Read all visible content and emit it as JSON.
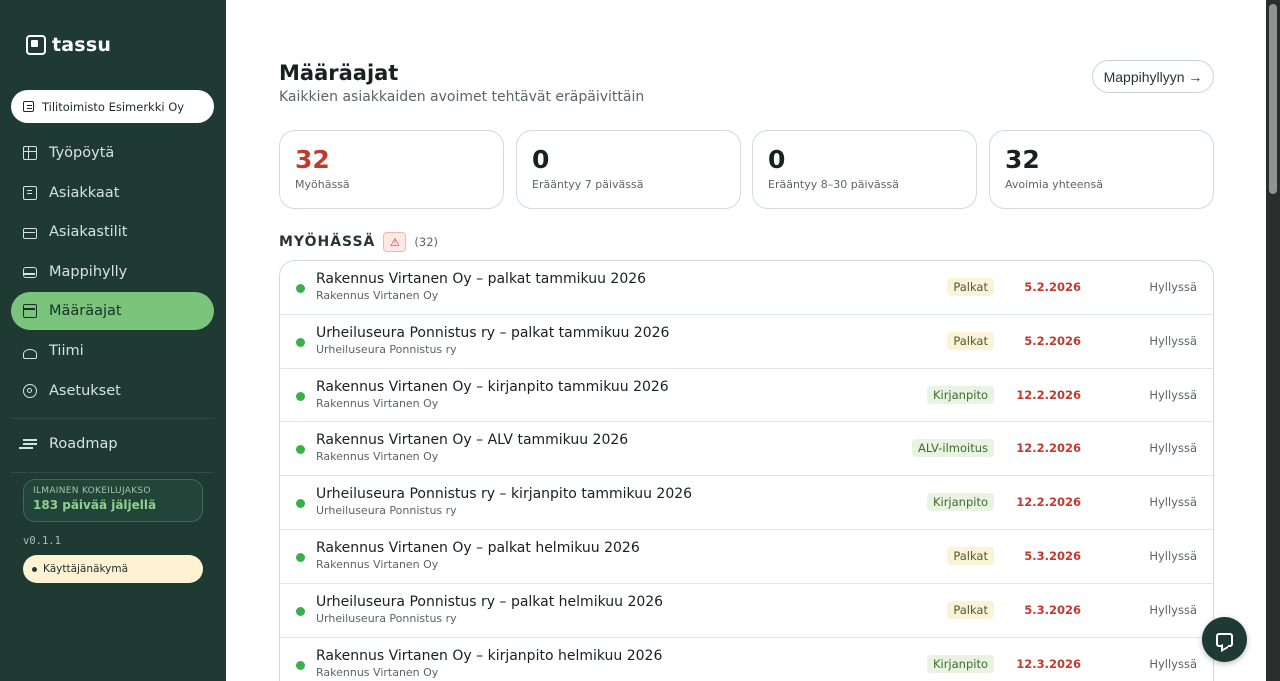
{
  "brand": {
    "name": "tassu"
  },
  "org_selector": {
    "label": "Tilitoimisto Esimerkki Oy"
  },
  "nav": [
    {
      "label": "Työpöytä",
      "icon": "dashboard-icon",
      "active": false
    },
    {
      "label": "Asiakkaat",
      "icon": "building-icon",
      "active": false
    },
    {
      "label": "Asiakastilit",
      "icon": "card-icon",
      "active": false
    },
    {
      "label": "Mappihylly",
      "icon": "inbox-icon",
      "active": false
    },
    {
      "label": "Määräajat",
      "icon": "calendar-icon",
      "active": true
    },
    {
      "label": "Tiimi",
      "icon": "users-icon",
      "active": false
    },
    {
      "label": "Asetukset",
      "icon": "gear-icon",
      "active": false
    }
  ],
  "roadmap": {
    "label": "Roadmap"
  },
  "trial": {
    "kicker": "ILMAINEN KOKEILUJAKSO",
    "days_left": "183 päivää jäljellä"
  },
  "version": "v0.1.1",
  "user_view": {
    "label": "Käyttäjänäkymä"
  },
  "page": {
    "title": "Määräajat",
    "subtitle": "Kaikkien asiakkaiden avoimet tehtävät eräpäivittäin",
    "shelf_button": "Mappihyllyyn →"
  },
  "stats": [
    {
      "value": "32",
      "label": "Myöhässä",
      "color": "#c2392e"
    },
    {
      "value": "0",
      "label": "Erääntyy 7 päivässä"
    },
    {
      "value": "0",
      "label": "Erääntyy 8–30 päivässä"
    },
    {
      "value": "32",
      "label": "Avoimia yhteensä"
    }
  ],
  "section": {
    "title": "MYÖHÄSSÄ",
    "warning_icon": "⚠",
    "count": "(32)"
  },
  "tasks": [
    {
      "title": "Rakennus Virtanen Oy – palkat tammikuu 2026",
      "client": "Rakennus Virtanen Oy",
      "tag": "Palkat",
      "date": "5.2.2026",
      "status": "Hyllyssä"
    },
    {
      "title": "Urheiluseura Ponnistus ry – palkat tammikuu 2026",
      "client": "Urheiluseura Ponnistus ry",
      "tag": "Palkat",
      "date": "5.2.2026",
      "status": "Hyllyssä"
    },
    {
      "title": "Rakennus Virtanen Oy – kirjanpito tammikuu 2026",
      "client": "Rakennus Virtanen Oy",
      "tag": "Kirjanpito",
      "date": "12.2.2026",
      "status": "Hyllyssä"
    },
    {
      "title": "Rakennus Virtanen Oy – ALV tammikuu 2026",
      "client": "Rakennus Virtanen Oy",
      "tag": "ALV-ilmoitus",
      "date": "12.2.2026",
      "status": "Hyllyssä"
    },
    {
      "title": "Urheiluseura Ponnistus ry – kirjanpito tammikuu 2026",
      "client": "Urheiluseura Ponnistus ry",
      "tag": "Kirjanpito",
      "date": "12.2.2026",
      "status": "Hyllyssä"
    },
    {
      "title": "Rakennus Virtanen Oy – palkat helmikuu 2026",
      "client": "Rakennus Virtanen Oy",
      "tag": "Palkat",
      "date": "5.3.2026",
      "status": "Hyllyssä"
    },
    {
      "title": "Urheiluseura Ponnistus ry – palkat helmikuu 2026",
      "client": "Urheiluseura Ponnistus ry",
      "tag": "Palkat",
      "date": "5.3.2026",
      "status": "Hyllyssä"
    },
    {
      "title": "Rakennus Virtanen Oy – kirjanpito helmikuu 2026",
      "client": "Rakennus Virtanen Oy",
      "tag": "Kirjanpito",
      "date": "12.3.2026",
      "status": "Hyllyssä"
    }
  ],
  "colors": {
    "sidebar": "#1e3a32",
    "accent": "#7bc47b",
    "overdue": "#c2392e",
    "status_dot": "#3ab04a"
  }
}
